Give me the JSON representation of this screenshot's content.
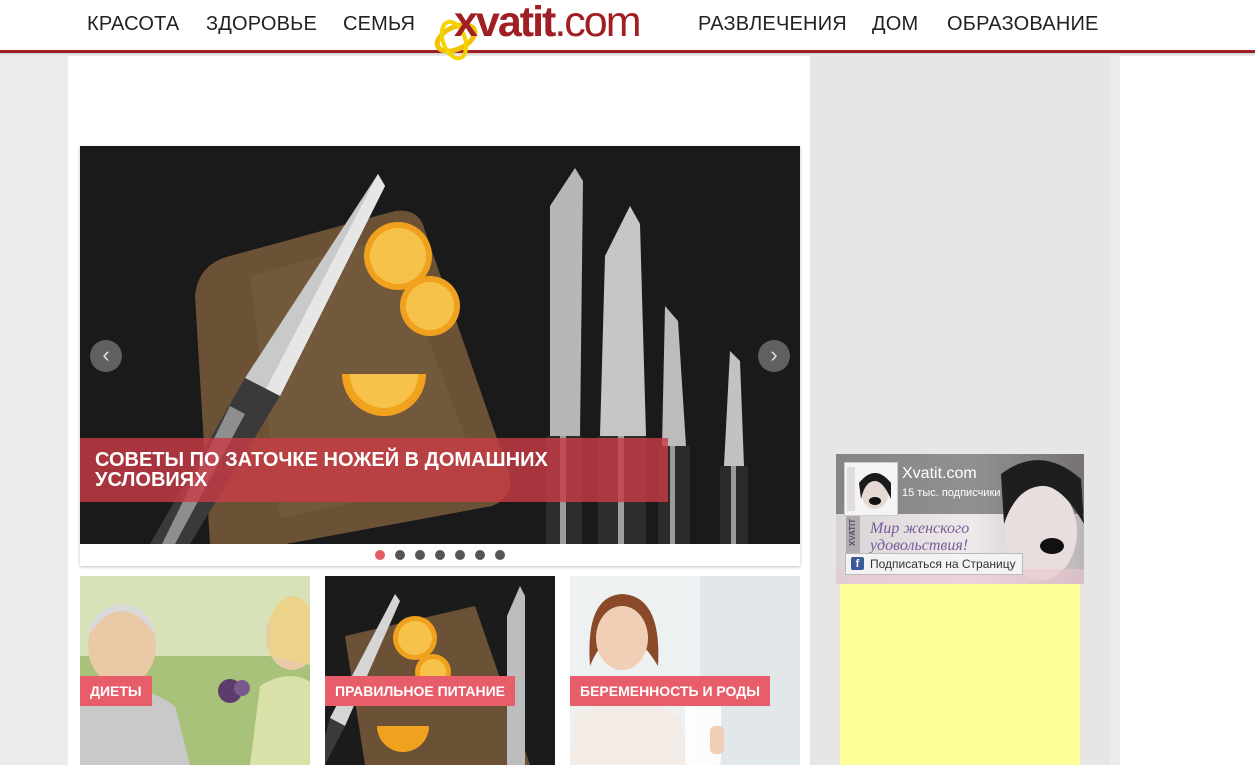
{
  "nav": {
    "left": [
      "КРАСОТА",
      "ЗДОРОВЬЕ",
      "СЕМЬЯ"
    ],
    "right": [
      "РАЗВЛЕЧЕНИЯ",
      "ДОМ",
      "ОБРАЗОВАНИЕ"
    ]
  },
  "logo": {
    "bold": "xvatit",
    "light": ".com"
  },
  "slider": {
    "caption": "СОВЕТЫ ПО ЗАТОЧКЕ НОЖЕЙ В ДОМАШНИХ УСЛОВИЯХ",
    "prev": "‹",
    "next": "›",
    "dot_count": 7,
    "active_dot": 1
  },
  "cards": [
    {
      "tag": "ДИЕТЫ"
    },
    {
      "tag": "ПРАВИЛЬНОЕ ПИТАНИЕ"
    },
    {
      "tag": "БЕРЕМЕННОСТЬ И РОДЫ"
    }
  ],
  "facebook": {
    "page_name": "Xvatit.com",
    "subscribers": "15 тыс. подписчики",
    "tagline_1": "Мир женского",
    "tagline_2": "удовольствия!",
    "cover_side_text": "XVATIT",
    "subscribe_button": "Подписаться на Страницу",
    "fb_letter": "f"
  },
  "colors": {
    "accent": "#a01f24",
    "tag": "#e85d6a",
    "ad_yellow": "#ffff99"
  }
}
